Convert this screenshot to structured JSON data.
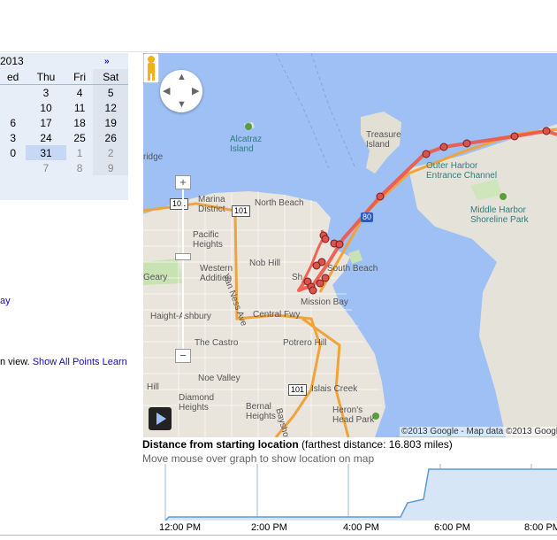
{
  "calendar": {
    "year_label": "2013",
    "next_label": "»",
    "weekdays": [
      "ed",
      "Thu",
      "Fri",
      "Sat"
    ],
    "rows": [
      [
        "",
        "3",
        "4",
        "5"
      ],
      [
        "",
        "10",
        "11",
        "12"
      ],
      [
        "6",
        "17",
        "18",
        "19"
      ],
      [
        "3",
        "24",
        "25",
        "26"
      ],
      [
        "0",
        "31",
        "1",
        "2"
      ],
      [
        "",
        "7",
        "8",
        "9"
      ]
    ],
    "selected_day": "31"
  },
  "sidebar": {
    "link_fragment": "ay",
    "view_text": "n view.",
    "show_all_points": "Show All Points",
    "learn": "Learn"
  },
  "map": {
    "labels": {
      "alcatraz": "Alcatraz\nIsland",
      "treasure": "Treasure\nIsland",
      "outer_harbor": "Outer Harbor\nEntrance Channel",
      "middle_harbor": "Middle Harbor\nShoreline Park",
      "marina": "Marina\nDistrict",
      "north_beach": "North Beach",
      "pacific_heights": "Pacific\nHeights",
      "nob_hill": "Nob Hill",
      "western_addition": "Western\nAddition",
      "van_ness": "Van Ness Ave",
      "south_beach": "South Beach",
      "mission_bay": "Mission Bay",
      "central_fwy": "Central Fwy",
      "haight": "Haight-Ashbury",
      "castro": "The Castro",
      "potrero": "Potrero Hill",
      "noe": "Noe Valley",
      "hill": "Hill",
      "diamond": "Diamond\nHeights",
      "bernal": "Bernal\nHeights",
      "islais": "Islais Creek",
      "herons": "Heron's\nHead Park",
      "bridge": "ridge",
      "geary": "Geary",
      "bayshore": "Bayshore",
      "sh": "Sh"
    },
    "shields": {
      "us101_a": "101",
      "us101_b": "101",
      "us101_c": "101",
      "i80": "80"
    },
    "copyright": "©2013 Google - Map data ©2013 Google",
    "logo_fragment": "Google",
    "pan_arrows": {
      "up": "▲",
      "down": "▼",
      "left": "◀",
      "right": "▶"
    },
    "zoom_in": "+",
    "zoom_out": "−",
    "route_color": "#f05545",
    "water_color": "#9ec0f5",
    "land_color": "#e9e5dc"
  },
  "graph": {
    "title_bold": "Distance from starting location",
    "title_rest": " (farthest distance: 16.803 miles)",
    "subtitle": "Move mouse over graph to show location on map",
    "ticks": [
      "12:00 PM",
      "2:00 PM",
      "4:00 PM",
      "6:00 PM",
      "8:00 PM"
    ],
    "fill_color": "#d6e6f7",
    "line_color": "#5b9bd5"
  }
}
